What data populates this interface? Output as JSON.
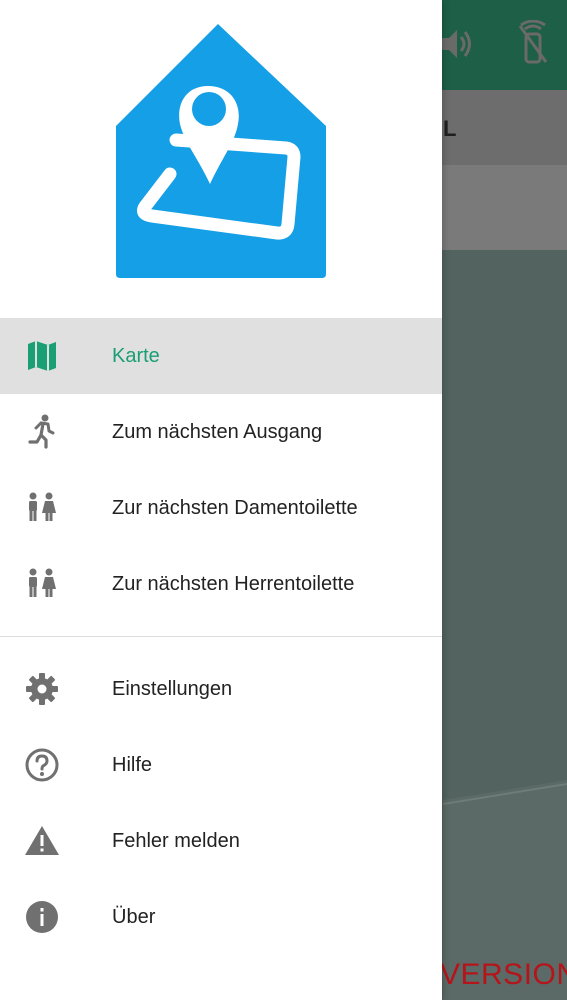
{
  "background": {
    "title_fragment": "L",
    "version_text": "VERSION",
    "topbar_color": "#1d5f47",
    "version_color": "#b5151a",
    "icons": [
      "volume-icon",
      "remote-off-icon"
    ]
  },
  "drawer": {
    "logo_color": "#149fe6",
    "accent_color": "#1a9e73",
    "menu_primary": [
      {
        "label": "Karte",
        "icon": "map-icon",
        "active": true
      },
      {
        "label": "Zum nächsten Ausgang",
        "icon": "running-person-icon",
        "active": false
      },
      {
        "label": "Zur nächsten Damentoilette",
        "icon": "restroom-icon",
        "active": false
      },
      {
        "label": "Zur nächsten Herrentoilette",
        "icon": "restroom-icon",
        "active": false
      }
    ],
    "menu_secondary": [
      {
        "label": "Einstellungen",
        "icon": "gear-icon"
      },
      {
        "label": "Hilfe",
        "icon": "help-circle-icon"
      },
      {
        "label": "Fehler melden",
        "icon": "warning-icon"
      },
      {
        "label": "Über",
        "icon": "info-icon"
      }
    ]
  }
}
